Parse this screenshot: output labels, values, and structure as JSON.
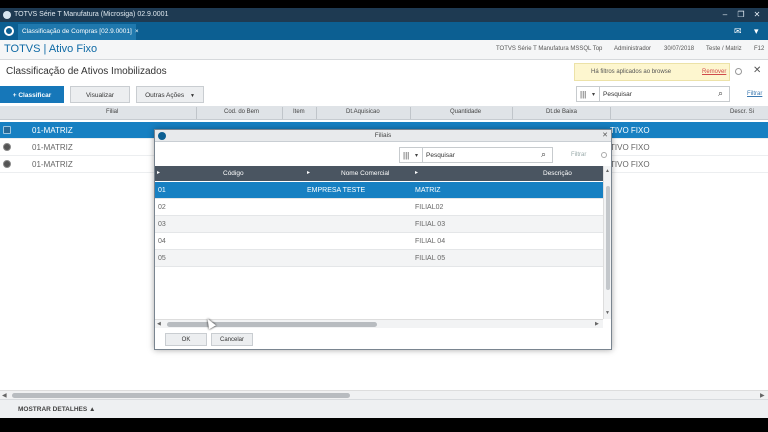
{
  "window": {
    "title": "TOTVS Série T Manufatura (Microsiga) 02.9.0001",
    "minimize": "–",
    "restore": "❐",
    "close": "✕"
  },
  "tabbar": {
    "tab_label": "Classificação de Compras [02.9.0001]",
    "tab_close": "×",
    "mail_icon": "✉",
    "user_icon": "▾"
  },
  "header": {
    "app_title": "TOTVS | Ativo Fixo",
    "system": "TOTVS Série T Manufatura MSSQL Top",
    "user": "Administrador",
    "date": "30/07/2018",
    "branch": "Teste / Matriz",
    "shortcut": "F12"
  },
  "page": {
    "title": "Classificação de Ativos Imobilizados",
    "filters_text": "Há filtros aplicados ao browse",
    "remove_filters": "Remover",
    "close": "✕"
  },
  "toolbar": {
    "classify": "+ Classificar",
    "view": "Visualizar",
    "other_actions": "Outras Ações",
    "other_actions_caret": "▼"
  },
  "search": {
    "placeholder": "Pesquisar",
    "value": "Pesquisar",
    "filter": "Filtrar"
  },
  "grid": {
    "columns": [
      "Filial",
      "Cod. do Bem",
      "Item",
      "Dt.Aquisicao",
      "Quantidade",
      "Dt.de Baixa",
      "Descr. Si"
    ],
    "rows": [
      {
        "filial": "01-MATRIZ",
        "desc": "TIVO FIXO",
        "selected": true
      },
      {
        "filial": "01-MATRIZ",
        "desc": "TIVO FIXO",
        "selected": false
      },
      {
        "filial": "01-MATRIZ",
        "desc": "TIVO FIXO",
        "selected": false
      }
    ]
  },
  "footer": {
    "details": "MOSTRAR DETALHES ▲"
  },
  "modal": {
    "title": "Filiais",
    "search_placeholder": "Pesquisar",
    "search_value": "Pesquisar",
    "filter": "Filtrar",
    "columns": [
      "Código",
      "Nome Comercial",
      "Descrição"
    ],
    "rows": [
      {
        "code": "01",
        "name": "EMPRESA TESTE",
        "desc": "MATRIZ",
        "selected": true
      },
      {
        "code": "02",
        "name": "",
        "desc": "FILIAL02",
        "selected": false
      },
      {
        "code": "03",
        "name": "",
        "desc": "FILIAL 03",
        "selected": false
      },
      {
        "code": "04",
        "name": "",
        "desc": "FILIAL 04",
        "selected": false
      },
      {
        "code": "05",
        "name": "",
        "desc": "FILIAL 05",
        "selected": false
      }
    ],
    "ok": "OK",
    "cancel": "Cancelar"
  },
  "colors": {
    "brand_blue": "#0c5f92",
    "selection_blue": "#1780c2",
    "modal_header": "#4a5561"
  }
}
